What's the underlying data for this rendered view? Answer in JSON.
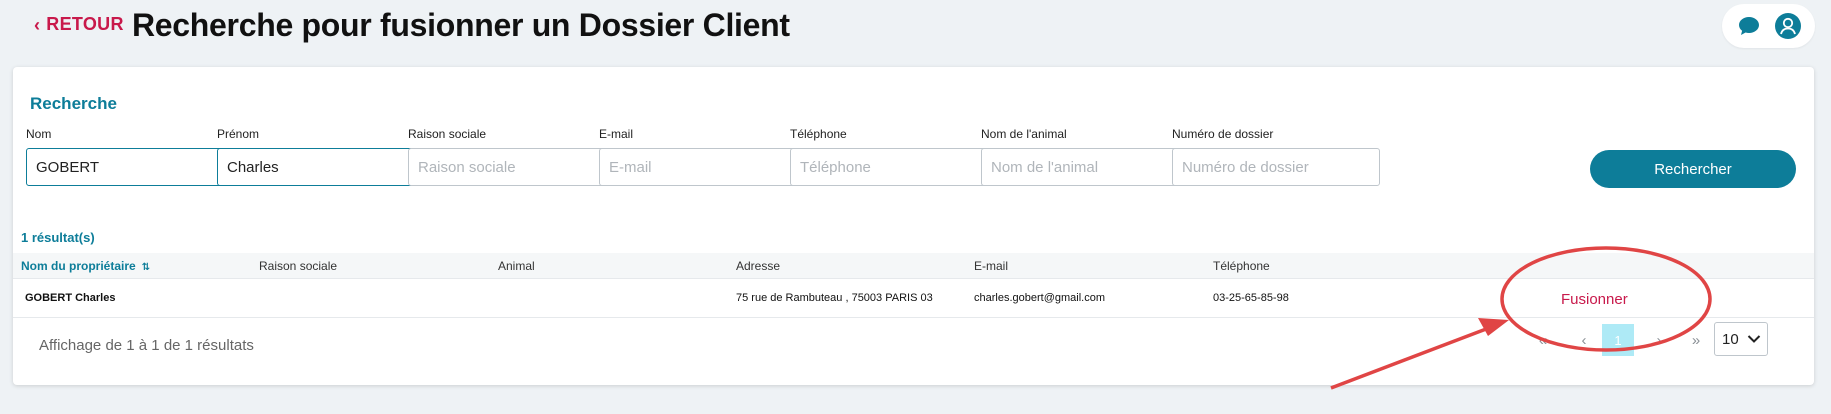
{
  "header": {
    "back_label": "RETOUR",
    "title": "Recherche pour fusionner un Dossier Client"
  },
  "search": {
    "section_title": "Recherche",
    "fields": [
      {
        "label": "Nom",
        "value": "GOBERT",
        "placeholder": ""
      },
      {
        "label": "Prénom",
        "value": "Charles",
        "placeholder": ""
      },
      {
        "label": "Raison sociale",
        "value": "",
        "placeholder": "Raison sociale"
      },
      {
        "label": "E-mail",
        "value": "",
        "placeholder": "E-mail"
      },
      {
        "label": "Téléphone",
        "value": "",
        "placeholder": "Téléphone"
      },
      {
        "label": "Nom de l'animal",
        "value": "",
        "placeholder": "Nom de l'animal"
      },
      {
        "label": "Numéro de dossier",
        "value": "",
        "placeholder": "Numéro de dossier"
      }
    ],
    "button_label": "Rechercher"
  },
  "results": {
    "count_label": "1 résultat(s)",
    "columns": [
      "Nom du propriétaire",
      "Raison sociale",
      "Animal",
      "Adresse",
      "E-mail",
      "Téléphone"
    ],
    "rows": [
      {
        "owner": "GOBERT Charles",
        "company": "",
        "animal": "",
        "address": "75 rue de Rambuteau , 75003 PARIS 03",
        "email": "charles.gobert@gmail.com",
        "phone": "03-25-65-85-98",
        "action": "Fusionner"
      }
    ]
  },
  "pagination": {
    "info": "Affichage de 1 à 1 de 1 résultats",
    "first": "«",
    "prev": "‹",
    "current_page": "1",
    "next": "›",
    "last": "»",
    "page_size": "10"
  },
  "icons": {
    "back": "chevron-left-icon",
    "chat": "chat-bubble-icon",
    "user": "user-avatar-icon",
    "sort": "sort-icon",
    "dropdown": "chevron-down-icon"
  },
  "colors": {
    "accent": "#0d7d99",
    "link": "#c8194b",
    "annotation": "#e04545",
    "current_page": "#aeeaf6"
  }
}
